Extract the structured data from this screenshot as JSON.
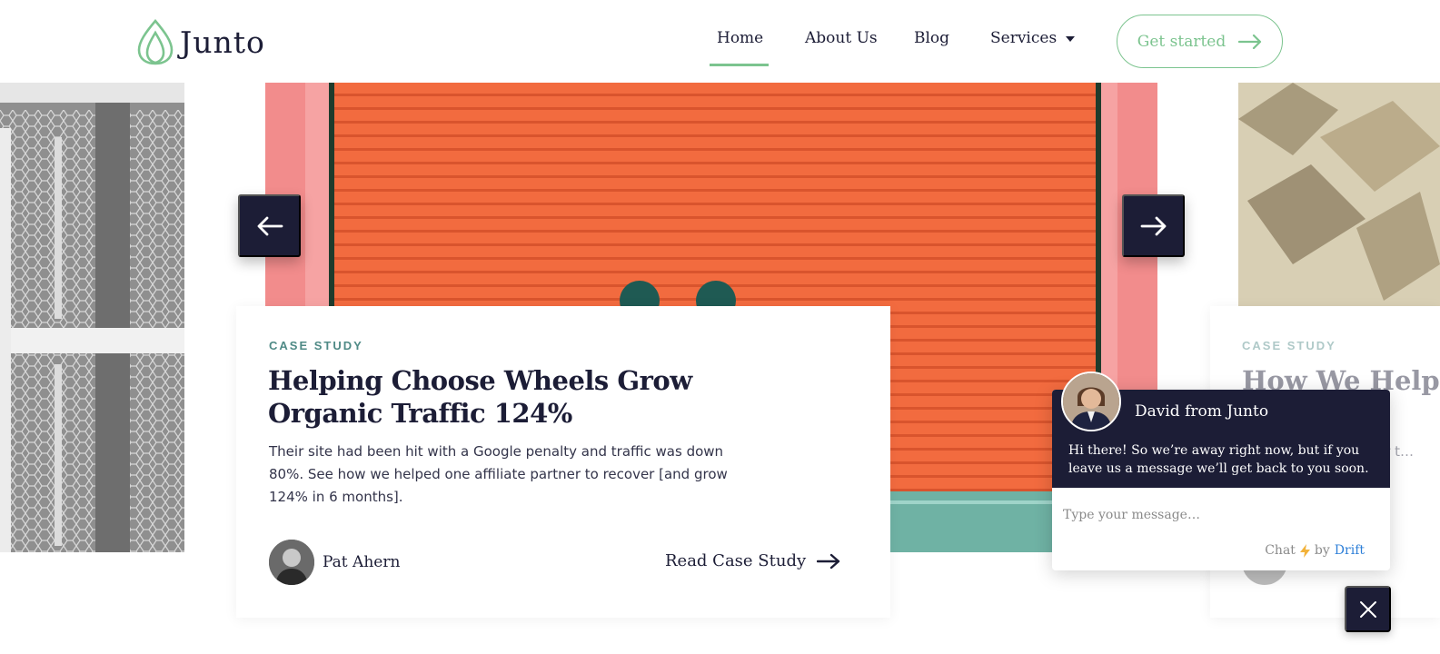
{
  "brand": {
    "name": "Junto",
    "accent": "#7cc48f",
    "navy": "#1c1d36"
  },
  "nav": {
    "items": [
      {
        "label": "Home",
        "active": true
      },
      {
        "label": "About Us"
      },
      {
        "label": "Blog"
      },
      {
        "label": "Services",
        "has_dropdown": true
      }
    ],
    "cta_label": "Get started"
  },
  "carousel": {
    "prev_icon": "arrow-left-icon",
    "next_icon": "arrow-right-icon",
    "active_card": {
      "tag": "CASE STUDY",
      "title": "Helping Choose Wheels Grow Organic Traffic 124%",
      "description": "Their site had been hit with a Google penalty and traffic was down 80%. See how we helped one affiliate partner to recover [and grow 124% in 6 months].",
      "author": "Pat Ahern",
      "link_label": "Read Case Study"
    },
    "next_card": {
      "tag": "CASE STUDY",
      "title": "How We Helpe… Traffic",
      "description": "…indu… …our… …ter t…"
    }
  },
  "chat": {
    "agent_name": "David from Junto",
    "message": "Hi there! So we’re away right now, but if you leave us a message we’ll get back to you soon.",
    "input_placeholder": "Type your message…",
    "branding_prefix": "Chat",
    "branding_by": "by",
    "branding_name": "Drift"
  }
}
